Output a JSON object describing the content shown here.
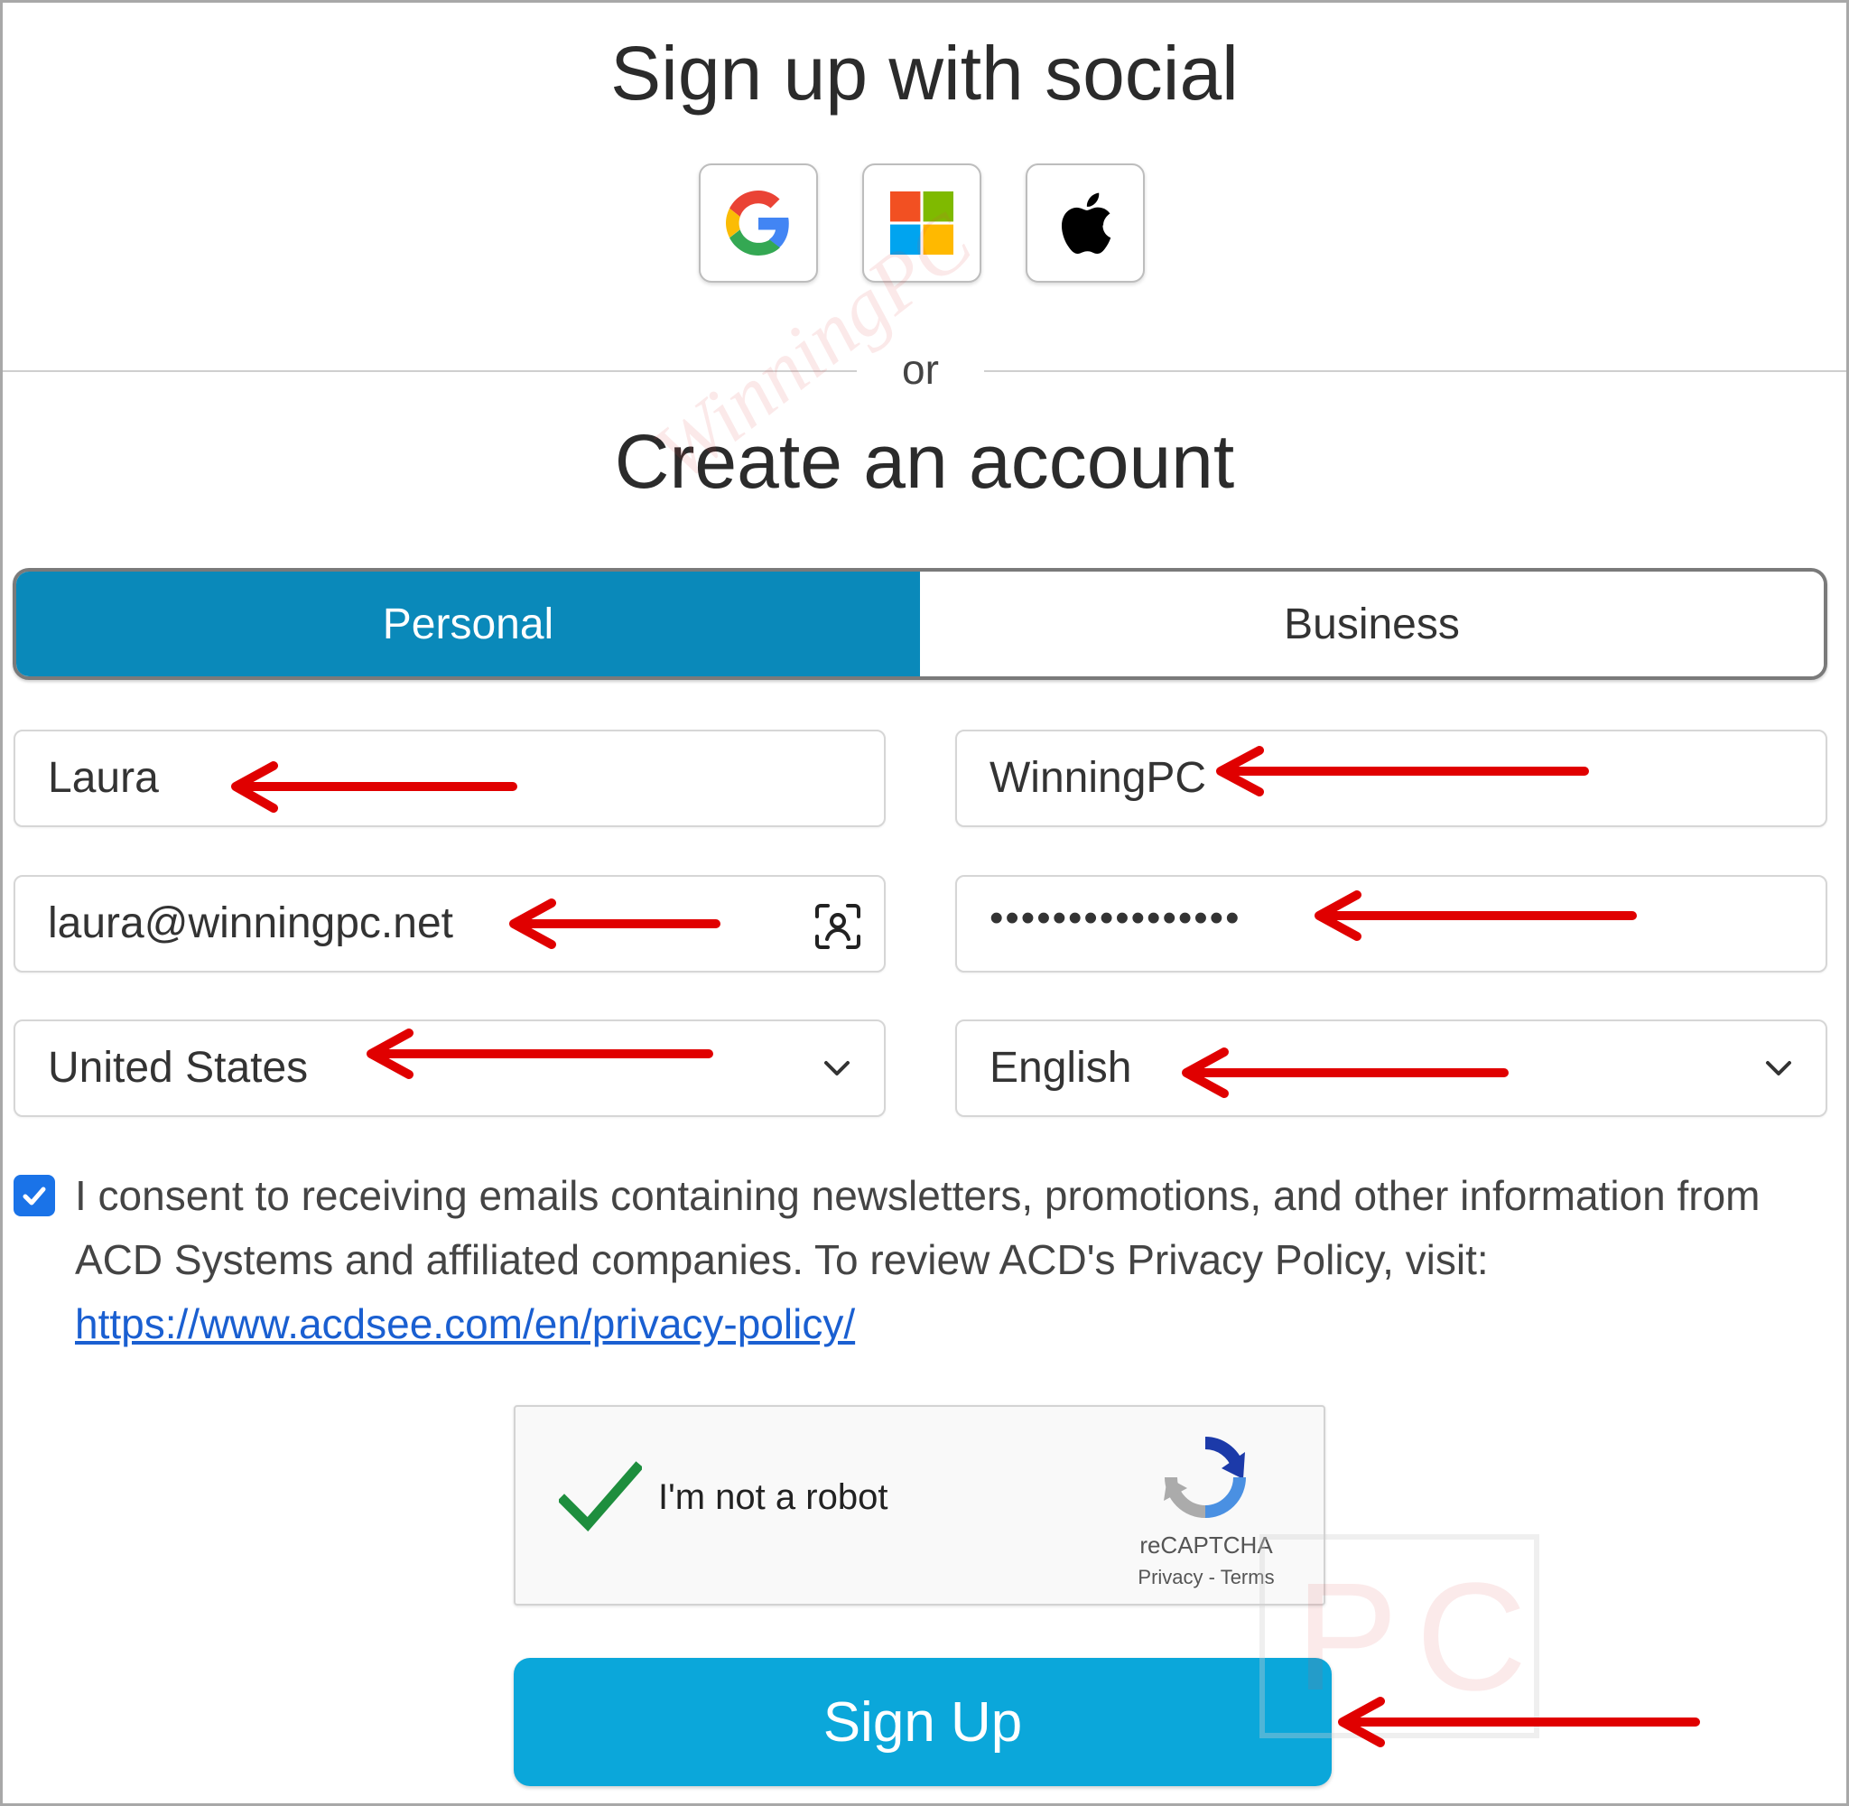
{
  "social": {
    "heading": "Sign up with social",
    "providers": [
      {
        "name": "Google",
        "icon": "google-icon"
      },
      {
        "name": "Microsoft",
        "icon": "microsoft-icon"
      },
      {
        "name": "Apple",
        "icon": "apple-icon"
      }
    ]
  },
  "divider": {
    "label": "or"
  },
  "account": {
    "heading": "Create an account",
    "tabs": {
      "personal": "Personal",
      "business": "Business",
      "selected": "Personal"
    }
  },
  "form": {
    "first_name": "Laura",
    "last_name": "WinningPC",
    "email": "laura@winningpc.net",
    "password_mask": "••••••••••••••••",
    "country": "United States",
    "language": "English",
    "consent": {
      "checked": true,
      "text": "I consent to receiving emails containing newsletters, promotions, and other information from ACD Systems and affiliated companies. To review ACD's Privacy Policy, visit: ",
      "link": "https://www.acdsee.com/en/privacy-policy/"
    }
  },
  "recaptcha": {
    "label": "I'm not a robot",
    "brand": "reCAPTCHA",
    "privacy": "Privacy",
    "separator": " - ",
    "terms": "Terms",
    "checked": true
  },
  "signup": {
    "label": "Sign Up"
  },
  "watermark": {
    "text": "WinningPC",
    "box_text": "PC"
  },
  "colors": {
    "personal_tab": "#0a89ba",
    "signup_button": "#0ba7da",
    "checkbox": "#1a73e8",
    "annotation_arrow": "#e00000",
    "link": "#1a5fd1"
  }
}
